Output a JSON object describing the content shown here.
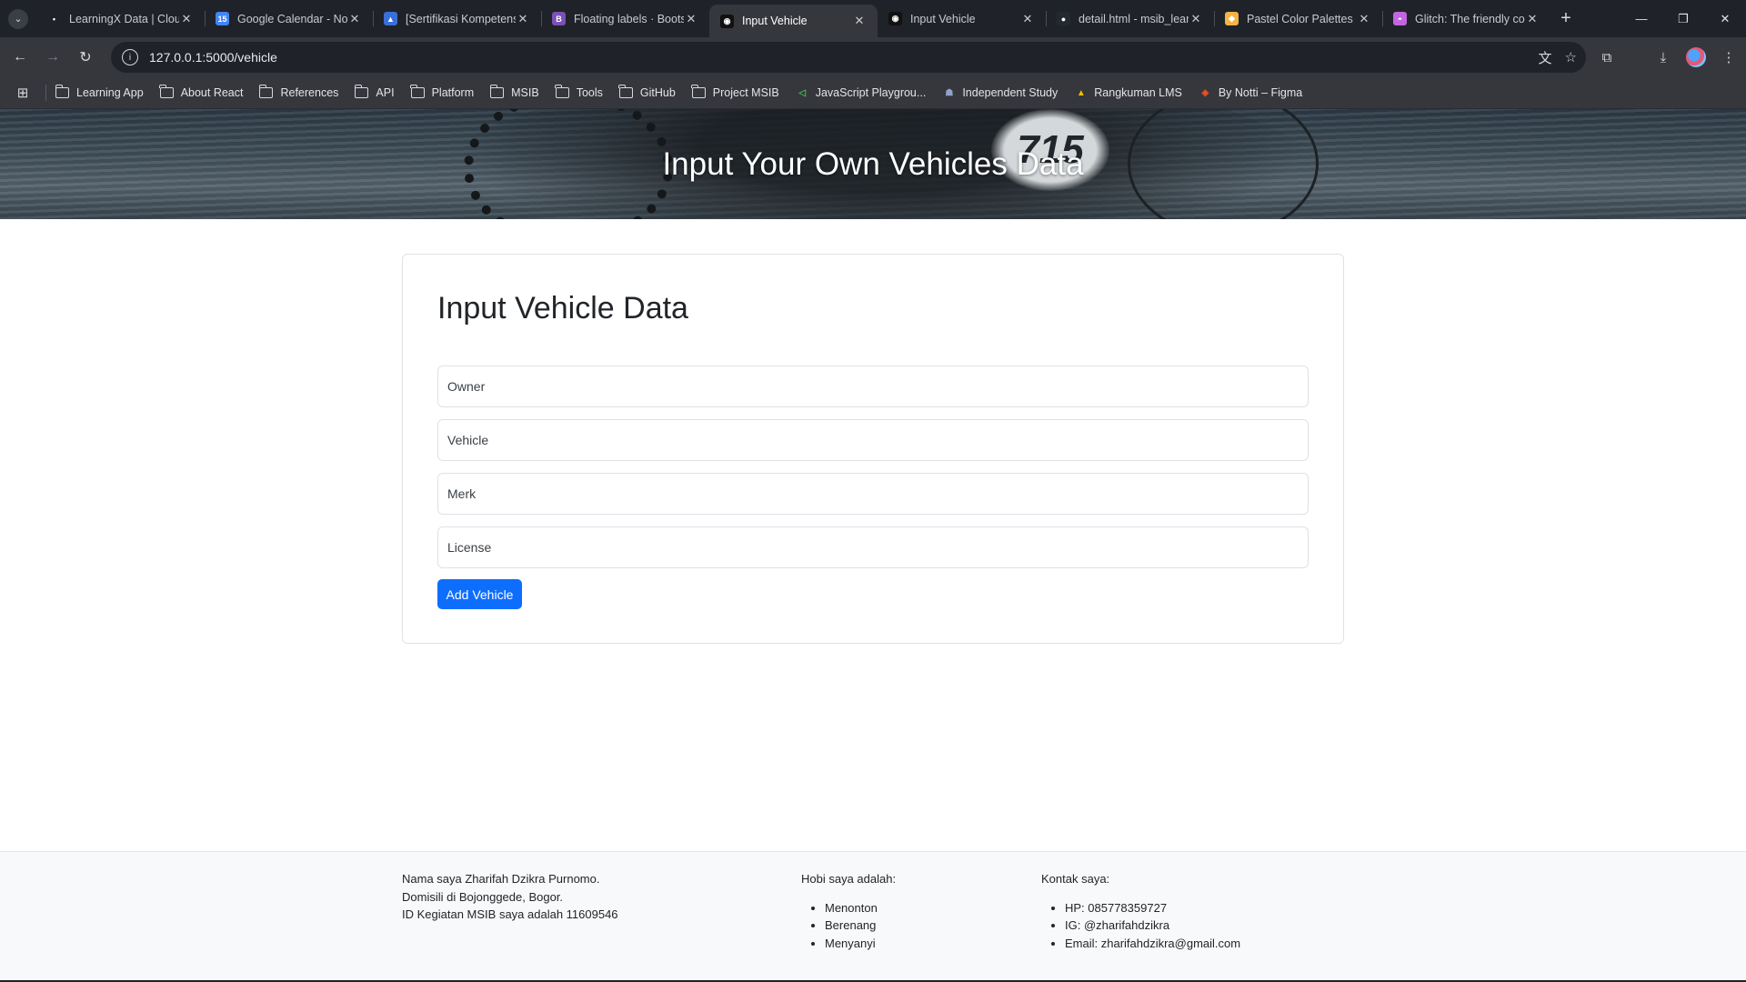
{
  "browser": {
    "tabs": [
      {
        "title": "LearningX Data | Cloud",
        "favicon_color": "#1f2229",
        "favicon_glyph": "•"
      },
      {
        "title": "Google Calendar - Notifications",
        "favicon_color": "#4285f4",
        "favicon_glyph": "15"
      },
      {
        "title": "[Sertifikasi Kompetensi",
        "favicon_color": "#3b6fd8",
        "favicon_glyph": "▲"
      },
      {
        "title": "Floating labels · Bootstrap",
        "favicon_color": "#7952b3",
        "favicon_glyph": "B"
      },
      {
        "title": "Input Vehicle",
        "favicon_color": "#111111",
        "favicon_glyph": "◉",
        "active": true
      },
      {
        "title": "Input Vehicle",
        "favicon_color": "#111111",
        "favicon_glyph": "◉"
      },
      {
        "title": "detail.html - msib_learning",
        "favicon_color": "#24292f",
        "favicon_glyph": "●"
      },
      {
        "title": "Pastel Color Palettes",
        "favicon_color": "#f2b544",
        "favicon_glyph": "◆"
      },
      {
        "title": "Glitch: The friendly community",
        "favicon_color": "#c266e0",
        "favicon_glyph": "◓"
      }
    ],
    "url": "127.0.0.1:5000/vehicle",
    "bookmarks": [
      {
        "label": "Learning App",
        "type": "folder"
      },
      {
        "label": "About React",
        "type": "folder"
      },
      {
        "label": "References",
        "type": "folder"
      },
      {
        "label": "API",
        "type": "folder"
      },
      {
        "label": "Platform",
        "type": "folder"
      },
      {
        "label": "MSIB",
        "type": "folder"
      },
      {
        "label": "Tools",
        "type": "folder"
      },
      {
        "label": "GitHub",
        "type": "folder"
      },
      {
        "label": "Project MSIB",
        "type": "folder"
      },
      {
        "label": "JavaScript Playgrou...",
        "type": "link",
        "icon_color": "#3fb950",
        "icon_glyph": "◁"
      },
      {
        "label": "Independent Study",
        "type": "link",
        "icon_color": "#8fa3c8",
        "icon_glyph": "☗"
      },
      {
        "label": "Rangkuman LMS",
        "type": "link",
        "icon_color": "#fbbc04",
        "icon_glyph": "▲"
      },
      {
        "label": "By Notti – Figma",
        "type": "link",
        "icon_color": "#f24e1e",
        "icon_glyph": "◈"
      }
    ]
  },
  "hero": {
    "title": "Input Your Own Vehicles Data",
    "plate_number": "715"
  },
  "form": {
    "heading": "Input Vehicle Data",
    "fields": [
      {
        "name": "owner",
        "placeholder": "Owner",
        "value": ""
      },
      {
        "name": "vehicle",
        "placeholder": "Vehicle",
        "value": ""
      },
      {
        "name": "merk",
        "placeholder": "Merk",
        "value": ""
      },
      {
        "name": "license",
        "placeholder": "License",
        "value": ""
      }
    ],
    "submit_label": "Add Vehicle",
    "submit_color": "#0d6efd"
  },
  "footer": {
    "about": {
      "line1": "Nama saya Zharifah Dzikra Purnomo.",
      "line2": "Domisili di Bojonggede, Bogor.",
      "line3": "ID Kegiatan MSIB saya adalah 11609546"
    },
    "hobbies": {
      "heading": "Hobi saya adalah:",
      "items": [
        "Menonton",
        "Berenang",
        "Menyanyi"
      ]
    },
    "contact": {
      "heading": "Kontak saya:",
      "items": [
        "HP: 085778359727",
        "IG: @zharifahdzikra",
        "Email: zharifahdzikra@gmail.com"
      ]
    }
  }
}
